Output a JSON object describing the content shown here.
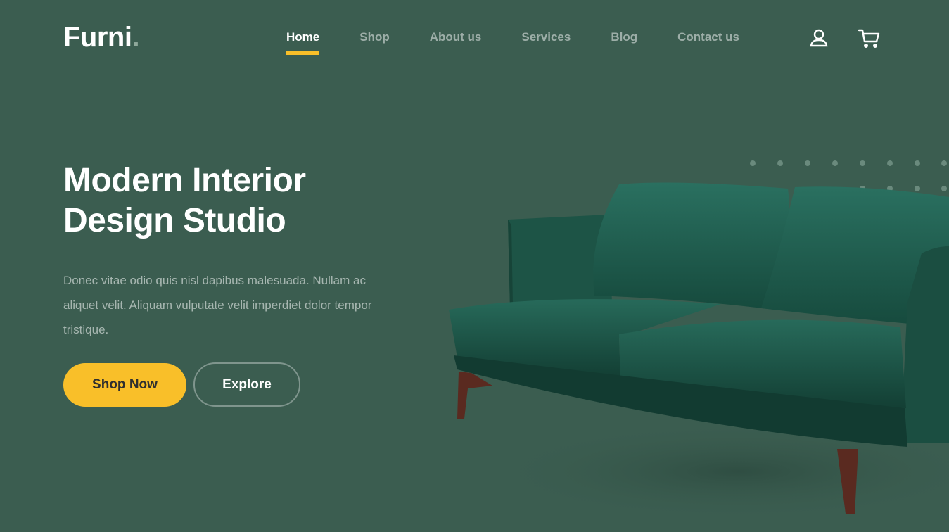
{
  "brand": {
    "name": "Furni",
    "dot": "."
  },
  "nav": {
    "items": [
      {
        "label": "Home",
        "active": true
      },
      {
        "label": "Shop",
        "active": false
      },
      {
        "label": "About us",
        "active": false
      },
      {
        "label": "Services",
        "active": false
      },
      {
        "label": "Blog",
        "active": false
      },
      {
        "label": "Contact us",
        "active": false
      }
    ],
    "icons": [
      "user-icon",
      "cart-icon"
    ]
  },
  "hero": {
    "title_line1": "Modern Interior",
    "title_line2": "Design Studio",
    "description": "Donec vitae odio quis nisl dapibus malesuada. Nullam ac aliquet velit. Aliquam vulputate velit imperdiet dolor tempor tristique.",
    "primary_button": "Shop Now",
    "secondary_button": "Explore"
  },
  "colors": {
    "background": "#3b5d50",
    "accent": "#f9bf29",
    "text": "#ffffff",
    "muted_text": "#a9bbb3",
    "sofa": "#1f5a4a"
  }
}
